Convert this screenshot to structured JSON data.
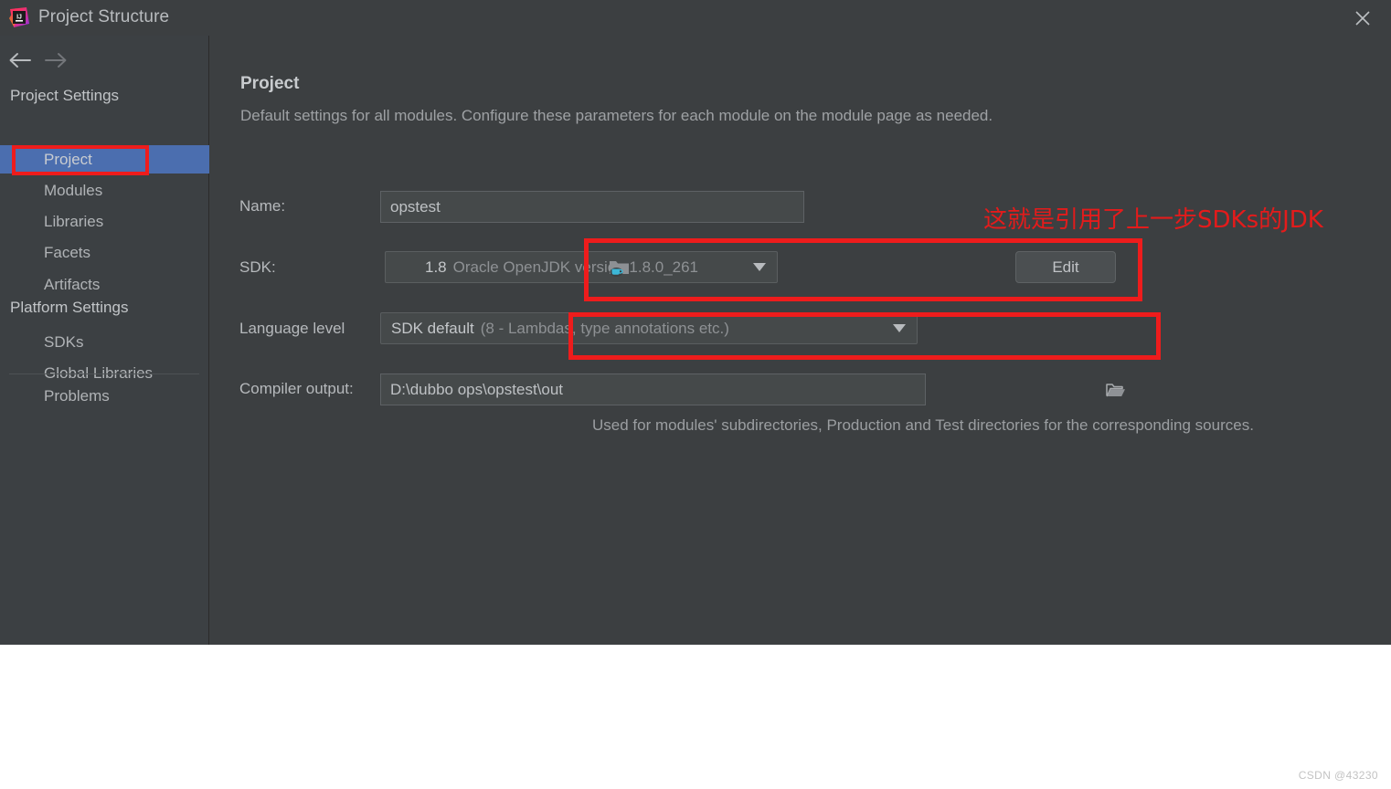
{
  "window": {
    "title": "Project Structure",
    "app_icon": "intellij-idea-icon",
    "close_icon": "close-icon"
  },
  "nav": {
    "back_icon": "arrow-left-icon",
    "forward_icon": "arrow-right-icon"
  },
  "sidebar": {
    "groups": [
      {
        "label": "Project Settings"
      },
      {
        "label": "Platform Settings"
      }
    ],
    "project_settings_items": [
      {
        "label": "Project",
        "selected": true
      },
      {
        "label": "Modules",
        "selected": false
      },
      {
        "label": "Libraries",
        "selected": false
      },
      {
        "label": "Facets",
        "selected": false
      },
      {
        "label": "Artifacts",
        "selected": false
      }
    ],
    "platform_settings_items": [
      {
        "label": "SDKs",
        "selected": false
      },
      {
        "label": "Global Libraries",
        "selected": false
      }
    ],
    "problems_item": {
      "label": "Problems",
      "selected": false
    }
  },
  "main": {
    "title": "Project",
    "subtitle": "Default settings for all modules. Configure these parameters for each module on the module page as needed.",
    "fields": {
      "name": {
        "label": "Name:",
        "value": "opstest"
      },
      "sdk": {
        "label": "SDK:",
        "icon": "folder-java-icon",
        "version": "1.8",
        "description": "Oracle OpenJDK version 1.8.0_261",
        "dropdown_icon": "chevron-down-icon",
        "edit_button": "Edit"
      },
      "language_level": {
        "label": "Language level",
        "value": "SDK default",
        "detail": "(8 - Lambdas, type annotations etc.)",
        "dropdown_icon": "chevron-down-icon"
      },
      "compiler_output": {
        "label": "Compiler output:",
        "value": "D:\\dubbo ops\\opstest\\out",
        "browse_icon": "folder-open-icon",
        "hint": "Used for modules' subdirectories, Production and Test directories for the corresponding sources."
      }
    }
  },
  "annotations": {
    "chinese_note": "这就是引用了上一步SDKs的JDK",
    "highlight_color": "#ee1c1c"
  },
  "watermark": {
    "text": "CSDN @43230"
  }
}
